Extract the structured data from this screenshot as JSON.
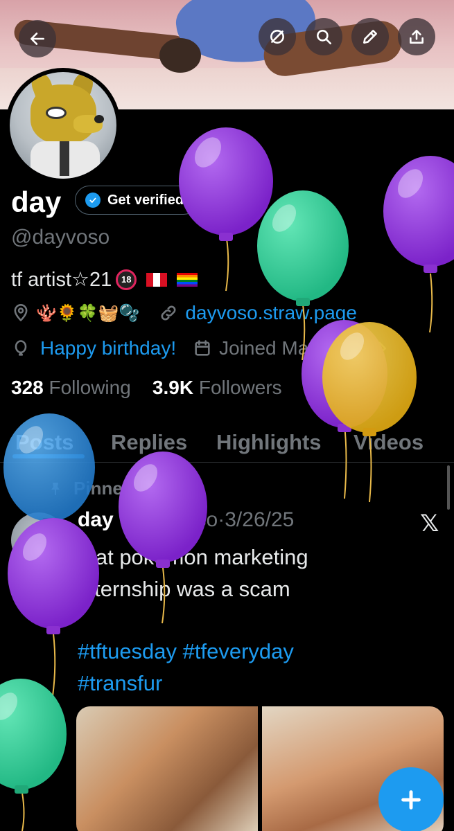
{
  "profile": {
    "display_name": "day",
    "get_verified_label": "Get verified",
    "handle": "@dayvoso",
    "bio_text": "tf artist☆21",
    "bio_adult_badge": "18",
    "location_emojis": "🪸🌻🍀🧺🫧",
    "website": "dayvoso.straw.page",
    "birthday_text": "Happy birthday!",
    "joined_text": "Joined May 2020",
    "following_count": "328",
    "following_label": "Following",
    "followers_count": "3.9K",
    "followers_label": "Followers"
  },
  "tabs": [
    {
      "label": "Posts",
      "active": true
    },
    {
      "label": "Replies",
      "active": false
    },
    {
      "label": "Highlights",
      "active": false
    },
    {
      "label": "Videos",
      "active": false
    }
  ],
  "post": {
    "pinned_label": "Pinned",
    "author_name": "day",
    "author_handle": "@dayvoso",
    "separator": "·",
    "date": "3/26/25",
    "text_line1": "that pokemon marketing",
    "text_line2": "internship was a scam",
    "hashtags_line1": "#tftuesday #tfeveryday",
    "hashtags_line2": "#transfur",
    "platform_glyph": "𝕏"
  },
  "header_icons": [
    "back-arrow-icon",
    "circle-slash-icon",
    "search-icon",
    "pencil-icon",
    "share-icon"
  ],
  "colors": {
    "accent": "#1d9bf0",
    "balloon_purple": "#8a2be2",
    "balloon_green": "#2ed39a",
    "balloon_yellow": "#f0c020",
    "balloon_blue": "#2f8fe0"
  }
}
